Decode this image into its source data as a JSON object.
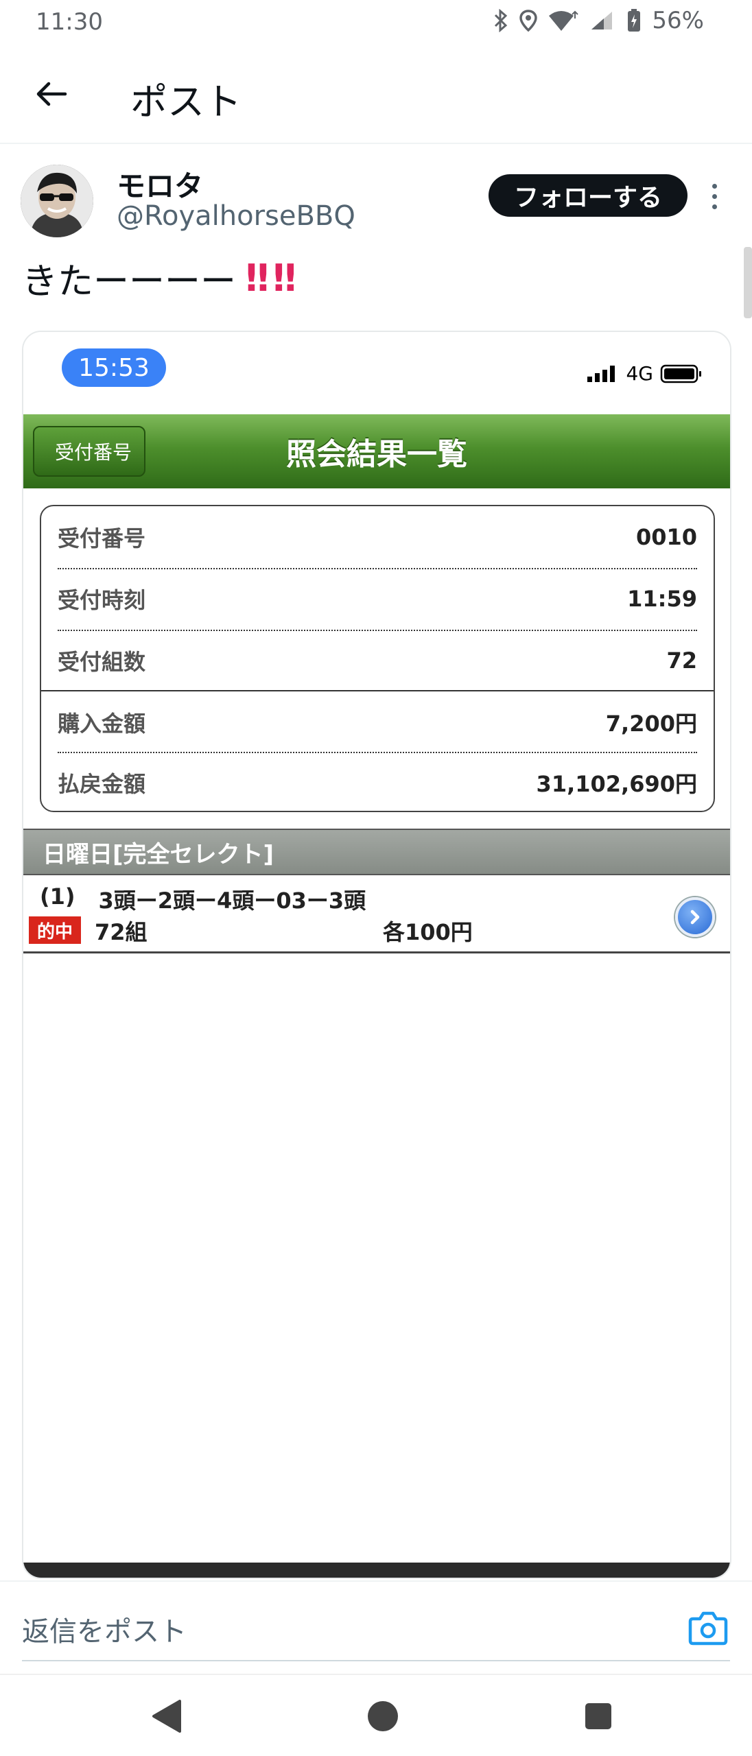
{
  "status_bar": {
    "time": "11:30",
    "battery": "56%"
  },
  "app_bar": {
    "back_icon": "arrow-left-icon",
    "title": "ポスト"
  },
  "post": {
    "display_name": "モロタ",
    "handle": "@RoyalhorseBBQ",
    "follow_label": "フォローする",
    "text": "きたーーーー",
    "emoji": "‼‼"
  },
  "embedded_image": {
    "status_time": "15:53",
    "network": "4G",
    "header_back_label": "受付番号",
    "header_title": "照会結果一覧",
    "rows": [
      {
        "label": "受付番号",
        "value": "0010"
      },
      {
        "label": "受付時刻",
        "value": "11:59"
      },
      {
        "label": "受付組数",
        "value": "72"
      },
      {
        "label": "購入金額",
        "value": "7,200円"
      },
      {
        "label": "払戻金額",
        "value": "31,102,690円"
      }
    ],
    "section_title": "日曜日[完全セレクト]",
    "bet": {
      "index": "(1)",
      "combination": "3頭ー2頭ー4頭ー03ー3頭",
      "hit_badge": "的中",
      "units": "72組",
      "each_amount": "各100円"
    }
  },
  "reply_bar": {
    "placeholder": "返信をポスト",
    "camera_icon": "camera-icon"
  },
  "nav_bar": {
    "back": "triangle-back-icon",
    "home": "circle-home-icon",
    "recents": "square-recents-icon"
  },
  "colors": {
    "accent": "#1d9bf0",
    "follow_button": "#0f1419",
    "emoji_red": "#e0245e",
    "header_green": "#4d8f2c",
    "hit_red": "#d9261c"
  }
}
